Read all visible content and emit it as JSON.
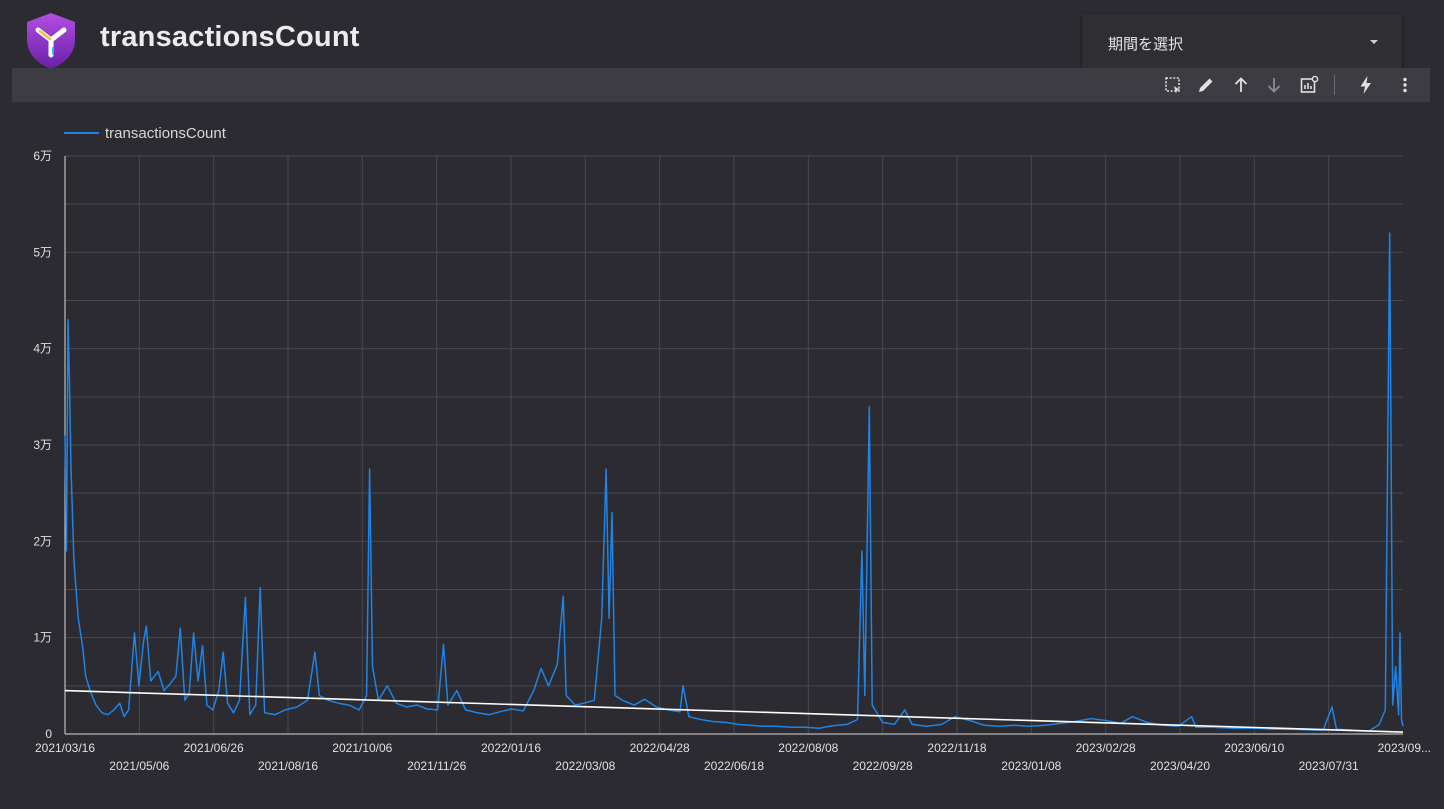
{
  "header": {
    "title": "transactionsCount"
  },
  "period_selector": {
    "label": "期間を選択"
  },
  "toolbar": {
    "icons": [
      "select-area-icon",
      "edit-icon",
      "sort-ascending-icon",
      "sort-descending-icon",
      "chart-settings-icon",
      "lightning-icon",
      "more-vert-icon"
    ]
  },
  "colors": {
    "background": "#2b2b31",
    "toolbar": "#3c3c42",
    "series": "#1f84e6",
    "trend": "#ffffff",
    "grid": "#4a4a50"
  },
  "chart_data": {
    "type": "line",
    "title": "",
    "legend": {
      "position": "top-left",
      "entries": [
        "transactionsCount"
      ]
    },
    "grid": true,
    "ylim": [
      0,
      60000
    ],
    "y_ticks": [
      0,
      10000,
      20000,
      30000,
      40000,
      50000,
      60000
    ],
    "y_tick_labels": [
      "0",
      "1万",
      "2万",
      "3万",
      "4万",
      "5万",
      "6万"
    ],
    "x_range": [
      "2021-03-16",
      "2023-09-07"
    ],
    "x_tick_labels": [
      "2021/03/16",
      "2021/05/06",
      "2021/06/26",
      "2021/08/16",
      "2021/10/06",
      "2021/11/26",
      "2022/01/16",
      "2022/03/08",
      "2022/04/28",
      "2022/06/18",
      "2022/08/08",
      "2022/09/28",
      "2022/11/18",
      "2023/01/08",
      "2023/02/28",
      "2023/04/20",
      "2023/06/10",
      "2023/07/31",
      "2023/09..."
    ],
    "series": [
      {
        "name": "transactionsCount",
        "points": [
          [
            "2021-03-16",
            31000
          ],
          [
            "2021-03-17",
            19000
          ],
          [
            "2021-03-18",
            43000
          ],
          [
            "2021-03-19",
            37000
          ],
          [
            "2021-03-20",
            28000
          ],
          [
            "2021-03-22",
            18000
          ],
          [
            "2021-03-25",
            12000
          ],
          [
            "2021-03-28",
            9000
          ],
          [
            "2021-03-30",
            6000
          ],
          [
            "2021-04-02",
            4500
          ],
          [
            "2021-04-06",
            3000
          ],
          [
            "2021-04-10",
            2200
          ],
          [
            "2021-04-14",
            2000
          ],
          [
            "2021-04-18",
            2500
          ],
          [
            "2021-04-22",
            3200
          ],
          [
            "2021-04-25",
            1800
          ],
          [
            "2021-04-28",
            2500
          ],
          [
            "2021-05-02",
            10500
          ],
          [
            "2021-05-05",
            5000
          ],
          [
            "2021-05-08",
            9500
          ],
          [
            "2021-05-10",
            11200
          ],
          [
            "2021-05-13",
            5500
          ],
          [
            "2021-05-18",
            6500
          ],
          [
            "2021-05-22",
            4500
          ],
          [
            "2021-05-26",
            5200
          ],
          [
            "2021-05-30",
            6000
          ],
          [
            "2021-06-02",
            11000
          ],
          [
            "2021-06-05",
            3500
          ],
          [
            "2021-06-08",
            4200
          ],
          [
            "2021-06-11",
            10500
          ],
          [
            "2021-06-14",
            5500
          ],
          [
            "2021-06-17",
            9200
          ],
          [
            "2021-06-20",
            3000
          ],
          [
            "2021-06-24",
            2500
          ],
          [
            "2021-06-28",
            4500
          ],
          [
            "2021-07-01",
            8500
          ],
          [
            "2021-07-04",
            3200
          ],
          [
            "2021-07-08",
            2200
          ],
          [
            "2021-07-12",
            3500
          ],
          [
            "2021-07-16",
            14200
          ],
          [
            "2021-07-19",
            2000
          ],
          [
            "2021-07-23",
            3000
          ],
          [
            "2021-07-26",
            15200
          ],
          [
            "2021-07-29",
            2200
          ],
          [
            "2021-08-05",
            2000
          ],
          [
            "2021-08-12",
            2500
          ],
          [
            "2021-08-20",
            2800
          ],
          [
            "2021-08-27",
            3500
          ],
          [
            "2021-09-01",
            8500
          ],
          [
            "2021-09-04",
            4000
          ],
          [
            "2021-09-10",
            3500
          ],
          [
            "2021-09-17",
            3200
          ],
          [
            "2021-09-24",
            3000
          ],
          [
            "2021-10-01",
            2500
          ],
          [
            "2021-10-06",
            4000
          ],
          [
            "2021-10-08",
            27500
          ],
          [
            "2021-10-10",
            7000
          ],
          [
            "2021-10-14",
            3500
          ],
          [
            "2021-10-20",
            5000
          ],
          [
            "2021-10-26",
            3200
          ],
          [
            "2021-11-02",
            2800
          ],
          [
            "2021-11-09",
            3000
          ],
          [
            "2021-11-16",
            2600
          ],
          [
            "2021-11-23",
            2500
          ],
          [
            "2021-11-27",
            9300
          ],
          [
            "2021-11-30",
            3000
          ],
          [
            "2021-12-06",
            4500
          ],
          [
            "2021-12-12",
            2500
          ],
          [
            "2021-12-20",
            2200
          ],
          [
            "2021-12-28",
            2000
          ],
          [
            "2022-01-04",
            2300
          ],
          [
            "2022-01-12",
            2600
          ],
          [
            "2022-01-20",
            2400
          ],
          [
            "2022-01-27",
            4500
          ],
          [
            "2022-02-01",
            6800
          ],
          [
            "2022-02-06",
            5000
          ],
          [
            "2022-02-12",
            7200
          ],
          [
            "2022-02-16",
            14300
          ],
          [
            "2022-02-18",
            4000
          ],
          [
            "2022-02-24",
            3000
          ],
          [
            "2022-03-02",
            3200
          ],
          [
            "2022-03-09",
            3500
          ],
          [
            "2022-03-14",
            12000
          ],
          [
            "2022-03-17",
            27500
          ],
          [
            "2022-03-19",
            12000
          ],
          [
            "2022-03-21",
            23000
          ],
          [
            "2022-03-23",
            4000
          ],
          [
            "2022-03-28",
            3500
          ],
          [
            "2022-04-05",
            3000
          ],
          [
            "2022-04-12",
            3600
          ],
          [
            "2022-04-20",
            2800
          ],
          [
            "2022-04-28",
            2500
          ],
          [
            "2022-05-06",
            2300
          ],
          [
            "2022-05-08",
            5000
          ],
          [
            "2022-05-12",
            1800
          ],
          [
            "2022-05-20",
            1500
          ],
          [
            "2022-05-28",
            1300
          ],
          [
            "2022-06-06",
            1200
          ],
          [
            "2022-06-14",
            1000
          ],
          [
            "2022-06-22",
            900
          ],
          [
            "2022-06-30",
            800
          ],
          [
            "2022-07-10",
            800
          ],
          [
            "2022-07-20",
            700
          ],
          [
            "2022-07-30",
            700
          ],
          [
            "2022-08-08",
            600
          ],
          [
            "2022-08-15",
            800
          ],
          [
            "2022-08-20",
            900
          ],
          [
            "2022-08-27",
            1000
          ],
          [
            "2022-09-03",
            1500
          ],
          [
            "2022-09-06",
            19000
          ],
          [
            "2022-09-08",
            4000
          ],
          [
            "2022-09-11",
            34000
          ],
          [
            "2022-09-13",
            3000
          ],
          [
            "2022-09-20",
            1200
          ],
          [
            "2022-09-28",
            1000
          ],
          [
            "2022-10-05",
            2500
          ],
          [
            "2022-10-10",
            1000
          ],
          [
            "2022-10-20",
            800
          ],
          [
            "2022-10-30",
            1000
          ],
          [
            "2022-11-08",
            1800
          ],
          [
            "2022-11-18",
            1400
          ],
          [
            "2022-11-28",
            900
          ],
          [
            "2022-12-08",
            800
          ],
          [
            "2022-12-18",
            900
          ],
          [
            "2022-12-28",
            800
          ],
          [
            "2023-01-08",
            900
          ],
          [
            "2023-01-18",
            1100
          ],
          [
            "2023-01-28",
            1300
          ],
          [
            "2023-02-08",
            1600
          ],
          [
            "2023-02-18",
            1400
          ],
          [
            "2023-02-28",
            1100
          ],
          [
            "2023-03-08",
            1800
          ],
          [
            "2023-03-18",
            1200
          ],
          [
            "2023-03-28",
            900
          ],
          [
            "2023-04-08",
            800
          ],
          [
            "2023-04-17",
            1800
          ],
          [
            "2023-04-20",
            700
          ],
          [
            "2023-05-01",
            700
          ],
          [
            "2023-05-15",
            600
          ],
          [
            "2023-06-01",
            600
          ],
          [
            "2023-06-10",
            500
          ],
          [
            "2023-06-25",
            500
          ],
          [
            "2023-07-08",
            400
          ],
          [
            "2023-07-15",
            400
          ],
          [
            "2023-07-21",
            2800
          ],
          [
            "2023-07-24",
            500
          ],
          [
            "2023-08-05",
            400
          ],
          [
            "2023-08-15",
            300
          ],
          [
            "2023-08-22",
            1000
          ],
          [
            "2023-08-26",
            2500
          ],
          [
            "2023-08-29",
            52000
          ],
          [
            "2023-08-31",
            3000
          ],
          [
            "2023-09-02",
            7000
          ],
          [
            "2023-09-04",
            2000
          ],
          [
            "2023-09-05",
            10500
          ],
          [
            "2023-09-06",
            1500
          ],
          [
            "2023-09-07",
            800
          ]
        ]
      },
      {
        "name": "",
        "kind": "trendline",
        "points": [
          [
            "2021-03-16",
            4500
          ],
          [
            "2023-09-07",
            200
          ]
        ]
      }
    ]
  }
}
